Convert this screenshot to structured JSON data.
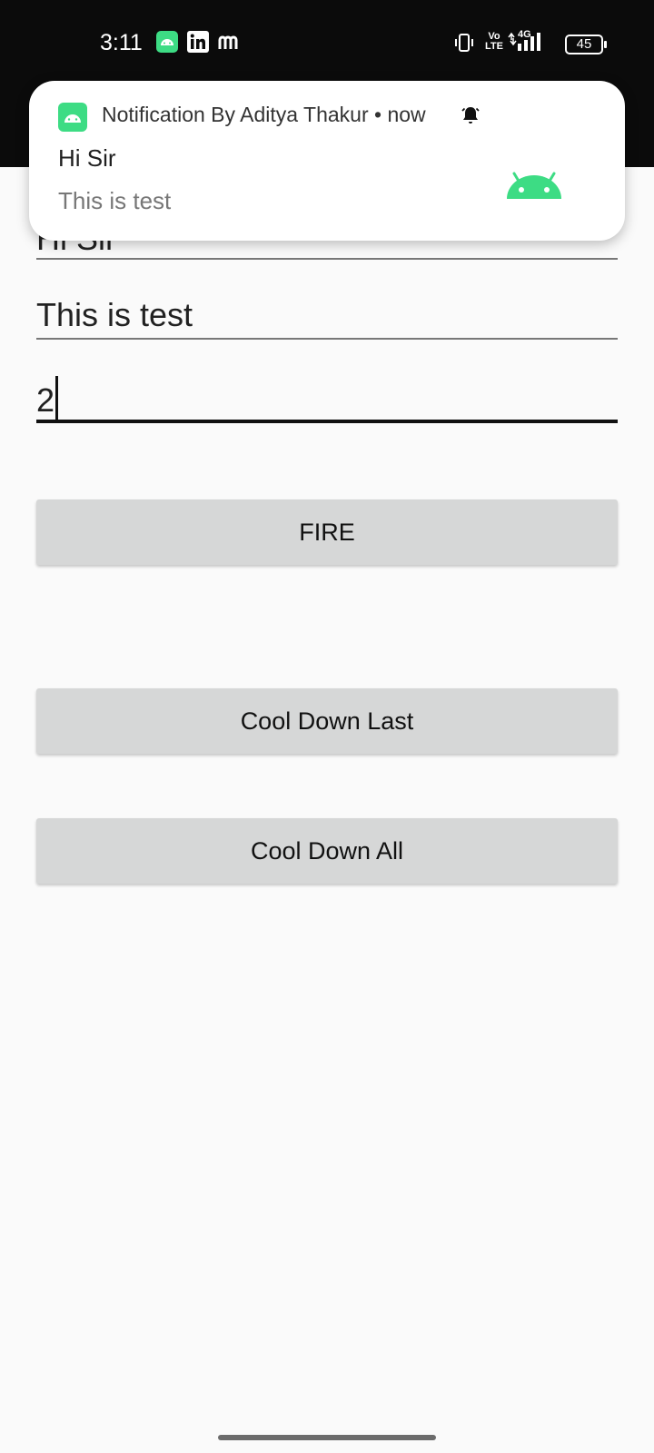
{
  "status_bar": {
    "time": "3:11",
    "battery_level": "45",
    "icons": [
      "android-app-icon",
      "linkedin-icon",
      "medium-icon",
      "vibrate-icon",
      "volte-icon",
      "signal-4g-icon",
      "battery-icon"
    ],
    "volte_label_top": "Vo",
    "volte_label_bottom": "LTE",
    "network_label": "4G"
  },
  "notification": {
    "app_name": "Notification By Aditya Thakur",
    "separator": "•",
    "time": "now",
    "title": "Hi Sir",
    "body": "This is test",
    "accent_color": "#3ddc84"
  },
  "form": {
    "title_field_value": "Hi Sir",
    "message_field_value": "This is test",
    "id_field_value": "2"
  },
  "buttons": {
    "fire": "FIRE",
    "cool_down_last": "Cool Down Last",
    "cool_down_all": "Cool Down All"
  }
}
